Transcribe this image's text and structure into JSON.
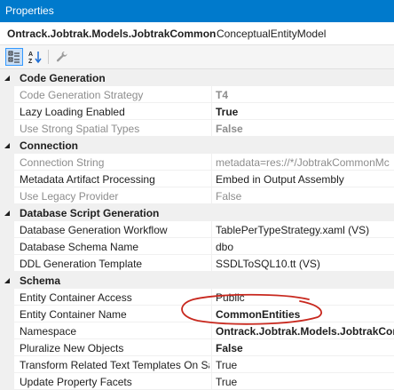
{
  "window": {
    "title": "Properties"
  },
  "object_selector": {
    "name": "Ontrack.Jobtrak.Models.JobtrakCommon",
    "type": "ConceptualEntityModel"
  },
  "toolbar": {
    "categorized_icon": "categorized-icon",
    "alphabetical_icon": "alphabetical-icon",
    "property_pages_icon": "wrench-icon"
  },
  "categories": [
    {
      "label": "Code Generation",
      "properties": [
        {
          "name": "Code Generation Strategy",
          "value": "T4"
        },
        {
          "name": "Lazy Loading Enabled",
          "value": "True"
        },
        {
          "name": "Use Strong Spatial Types",
          "value": "False"
        }
      ]
    },
    {
      "label": "Connection",
      "properties": [
        {
          "name": "Connection String",
          "value": "metadata=res://*/JobtrakCommonMc"
        },
        {
          "name": "Metadata Artifact Processing",
          "value": "Embed in Output Assembly"
        },
        {
          "name": "Use Legacy Provider",
          "value": "False"
        }
      ]
    },
    {
      "label": "Database Script Generation",
      "properties": [
        {
          "name": "Database Generation Workflow",
          "value": "TablePerTypeStrategy.xaml (VS)"
        },
        {
          "name": "Database Schema Name",
          "value": "dbo"
        },
        {
          "name": "DDL Generation Template",
          "value": "SSDLToSQL10.tt (VS)"
        }
      ]
    },
    {
      "label": "Schema",
      "properties": [
        {
          "name": "Entity Container Access",
          "value": "Public"
        },
        {
          "name": "Entity Container Name",
          "value": "CommonEntities"
        },
        {
          "name": "Namespace",
          "value": "Ontrack.Jobtrak.Models.JobtrakCom"
        },
        {
          "name": "Pluralize New Objects",
          "value": "False"
        },
        {
          "name": "Transform Related Text Templates On Sav",
          "value": "True"
        },
        {
          "name": "Update Property Facets",
          "value": "True"
        }
      ]
    }
  ],
  "colors": {
    "titlebar": "#007acc",
    "annotation": "#c8281e",
    "disabled_text": "#8d8d8d"
  }
}
